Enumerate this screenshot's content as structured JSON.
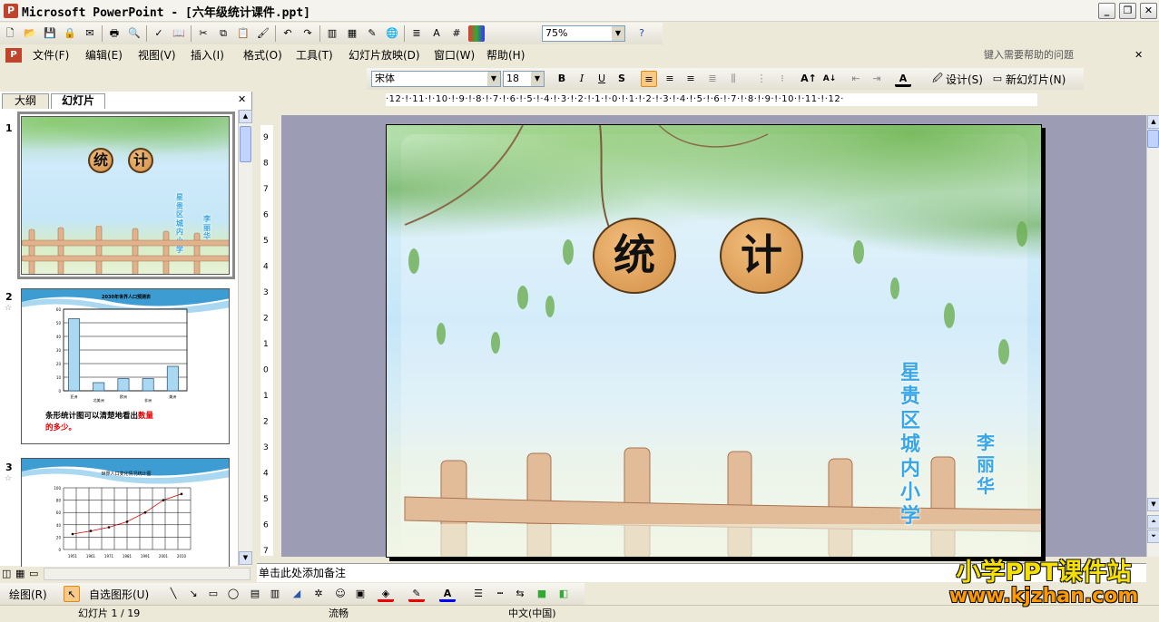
{
  "window": {
    "title": "Microsoft PowerPoint - [六年级统计课件.ppt]"
  },
  "toolbar": {
    "zoom": "75%"
  },
  "menu": {
    "items": [
      "文件(F)",
      "编辑(E)",
      "视图(V)",
      "插入(I)",
      "格式(O)",
      "工具(T)",
      "幻灯片放映(D)",
      "窗口(W)",
      "帮助(H)"
    ],
    "help_placeholder": "键入需要帮助的问题"
  },
  "format": {
    "font_name": "宋体",
    "font_size": "18",
    "bold": "B",
    "italic": "I",
    "underline": "U",
    "shadow": "S",
    "design": "设计(S)",
    "new_slide": "新幻灯片(N)"
  },
  "panel": {
    "tabs": [
      "大纲",
      "幻灯片"
    ],
    "active_tab": "幻灯片"
  },
  "thumbnails": [
    {
      "num": "1",
      "title_chars": [
        "统",
        "计"
      ],
      "school": "星贵区城内小学",
      "author": "李丽华"
    },
    {
      "num": "2",
      "chart_title": "2030年世界人口预测表",
      "caption_a": "条形统计图可以清楚地看出",
      "caption_b": "数量",
      "caption_c": "的多少。",
      "chart_data": {
        "type": "bar",
        "categories": [
          "亚洲",
          "北美洲",
          "欧洲",
          "非洲",
          "美洲"
        ],
        "values": [
          53,
          6,
          9,
          9,
          18
        ],
        "ylim": [
          0,
          60
        ],
        "yticks": [
          "0",
          "10",
          "20",
          "30",
          "40",
          "50",
          "60"
        ]
      }
    },
    {
      "num": "3",
      "chart_title": "世界人口变化情况统计图",
      "chart_data": {
        "type": "line",
        "x": [
          "1951",
          "1961",
          "1971",
          "1981",
          "1991",
          "2001",
          "2010"
        ],
        "values": [
          25,
          30,
          36,
          45,
          60,
          80,
          90
        ],
        "ylim": [
          0,
          100
        ],
        "yticks": [
          "0",
          "20",
          "40",
          "60",
          "80",
          "100"
        ]
      }
    }
  ],
  "slide": {
    "title_chars": [
      "统",
      "计"
    ],
    "school": "星贵区城内小学",
    "author": "李丽华"
  },
  "notes": {
    "placeholder": "单击此处添加备注"
  },
  "drawing": {
    "draw": "绘图(R)",
    "autoshapes": "自选图形(U)"
  },
  "status": {
    "slide": "幻灯片 1 / 19",
    "design": "流畅",
    "language": "中文(中国)"
  },
  "watermark": {
    "line1": "小学PPT课件站",
    "line2": "www.kjzhan.com"
  },
  "colors": {
    "title_circle": "#e0a35e",
    "school_text": "#39a7e7",
    "watermark_line1": "#f5e000",
    "watermark_line2": "#ff9900",
    "canvas_bg": "#9c9cb4"
  }
}
